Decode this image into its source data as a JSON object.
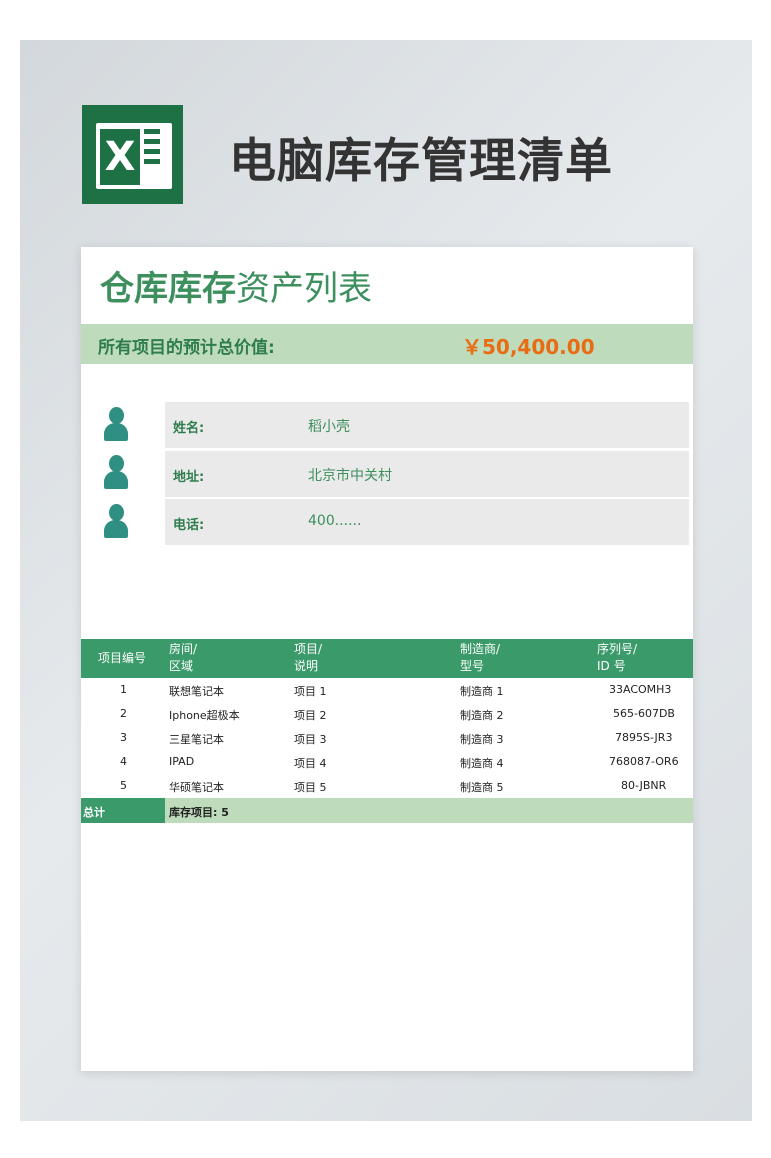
{
  "header": {
    "title": "电脑库存管理清单",
    "logo_letter": "X",
    "logo_icon": "excel-icon"
  },
  "card": {
    "title_bold": "仓库库存",
    "title_light": "资产列表",
    "total_label": "所有项目的预计总价值:",
    "total_value": "￥50,400.00"
  },
  "info": [
    {
      "key": "姓名:",
      "value": "稻小壳",
      "icon": "person-icon"
    },
    {
      "key": "地址:",
      "value": "北京市中关村",
      "icon": "person-icon"
    },
    {
      "key": "电话:",
      "value": "400......",
      "icon": "person-icon"
    }
  ],
  "table": {
    "headers": [
      {
        "line1": "项目编号",
        "line2": ""
      },
      {
        "line1": "房间/",
        "line2": "区域"
      },
      {
        "line1": "项目/",
        "line2": "说明"
      },
      {
        "line1": "制造商/",
        "line2": "型号"
      },
      {
        "line1": "序列号/",
        "line2": "ID 号"
      }
    ],
    "rows": [
      [
        "1",
        "联想笔记本",
        "项目 1",
        "制造商 1",
        "33ACOMH3"
      ],
      [
        "2",
        "Iphone超极本",
        "项目 2",
        "制造商 2",
        "565-607DB"
      ],
      [
        "3",
        "三星笔记本",
        "项目 3",
        "制造商 3",
        "7895S-JR3"
      ],
      [
        "4",
        "IPAD",
        "项目 4",
        "制造商 4",
        "768087-OR6"
      ],
      [
        "5",
        "华硕笔记本",
        "项目 5",
        "制造商 5",
        "80-JBNR"
      ]
    ],
    "summary": {
      "label": "总计",
      "text": "库存项目:  5"
    }
  },
  "colors": {
    "brand_green": "#3a9a69",
    "light_green": "#bedbbc",
    "accent_orange": "#e96b12",
    "excel_green": "#1e7145"
  }
}
